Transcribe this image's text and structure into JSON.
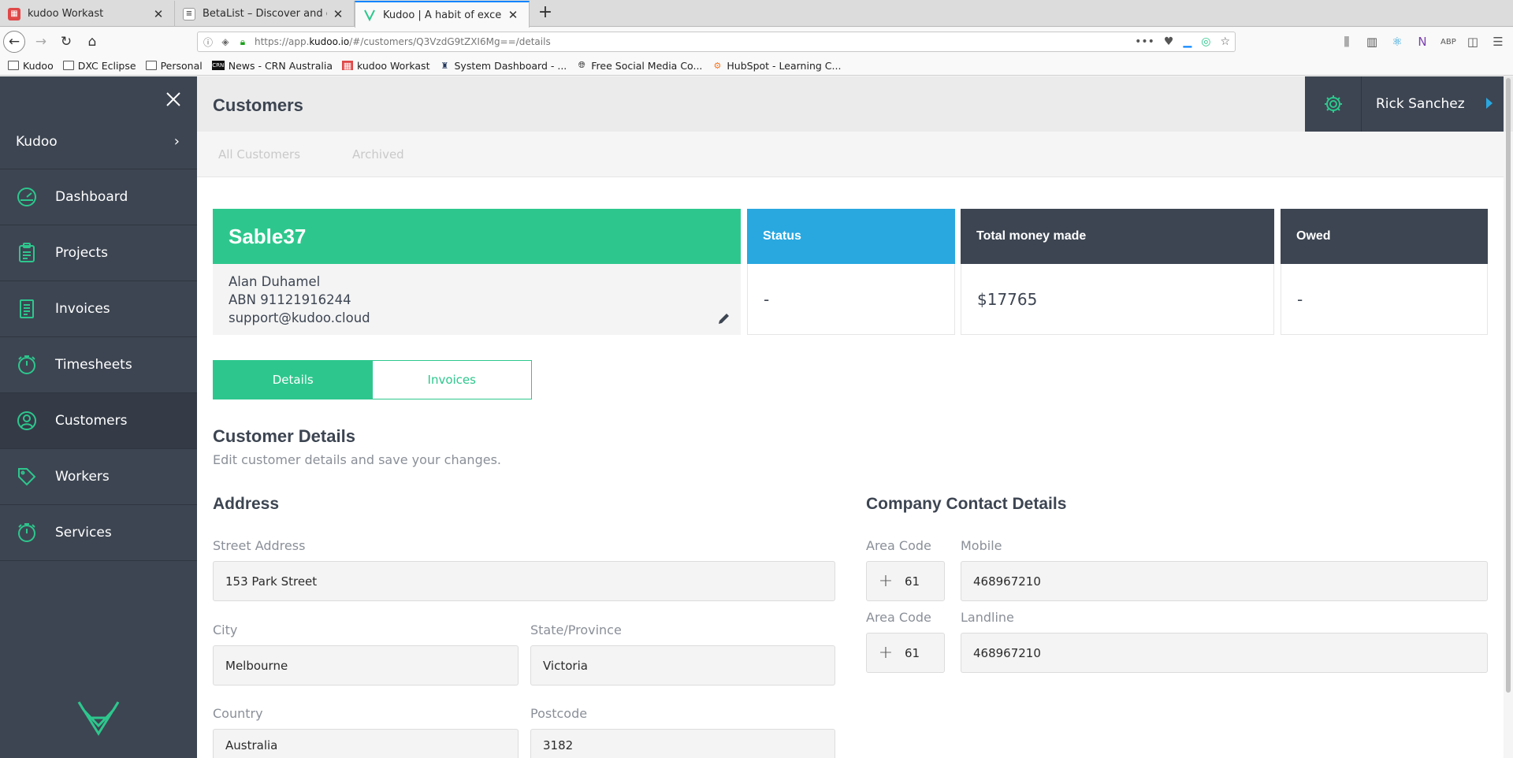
{
  "browser": {
    "tabs": [
      {
        "title": "kudoo Workast",
        "favicon_color": "#e04848"
      },
      {
        "title": "BetaList – Discover and get early",
        "favicon_color": "#9a9a9a"
      },
      {
        "title": "Kudoo | A habit of excellence",
        "favicon_color": "#2dc78d"
      }
    ],
    "url_prefix": "https://app.",
    "url_domain": "kudoo.io",
    "url_path": "/#/customers/Q3VzdG9tZXI6Mg==/details",
    "bookmarks": [
      {
        "label": "Kudoo",
        "icon": "folder-icon"
      },
      {
        "label": "DXC Eclipse",
        "icon": "folder-icon"
      },
      {
        "label": "Personal",
        "icon": "folder-icon"
      },
      {
        "label": "News - CRN Australia",
        "icon": "crn-icon"
      },
      {
        "label": "kudoo Workast",
        "icon": "workast-icon"
      },
      {
        "label": "System Dashboard - ...",
        "icon": "jira-icon"
      },
      {
        "label": "Free Social Media Co...",
        "icon": "globe-icon"
      },
      {
        "label": "HubSpot - Learning C...",
        "icon": "hubspot-icon"
      }
    ]
  },
  "sidebar": {
    "org": "Kudoo",
    "items": [
      {
        "label": "Dashboard",
        "icon": "dashboard-icon"
      },
      {
        "label": "Projects",
        "icon": "clipboard-icon"
      },
      {
        "label": "Invoices",
        "icon": "invoice-icon"
      },
      {
        "label": "Timesheets",
        "icon": "stopwatch-icon"
      },
      {
        "label": "Customers",
        "icon": "user-icon"
      },
      {
        "label": "Workers",
        "icon": "tag-icon"
      },
      {
        "label": "Services",
        "icon": "stopwatch-icon"
      }
    ],
    "active": "Customers"
  },
  "header": {
    "title": "Customers",
    "user": "Rick Sanchez"
  },
  "subtabs": [
    "All Customers",
    "Archived"
  ],
  "customer": {
    "name": "Sable37",
    "contact": "Alan Duhamel",
    "abn": "ABN 91121916244",
    "email": "support@kudoo.cloud"
  },
  "stats": {
    "status_label": "Status",
    "status_value": "-",
    "money_label": "Total money made",
    "money_value": "$17765",
    "owed_label": "Owed",
    "owed_value": "-"
  },
  "toggle": {
    "details": "Details",
    "invoices": "Invoices"
  },
  "details": {
    "title": "Customer Details",
    "subtitle": "Edit customer details and save your changes.",
    "address_title": "Address",
    "street_label": "Street Address",
    "street_value": "153 Park Street",
    "city_label": "City",
    "city_value": "Melbourne",
    "state_label": "State/Province",
    "state_value": "Victoria",
    "country_label": "Country",
    "country_value": "Australia",
    "postcode_label": "Postcode",
    "postcode_value": "3182",
    "contact_title": "Company Contact Details",
    "area_label": "Area Code",
    "mobile_label": "Mobile",
    "mobile_area": "61",
    "mobile_value": "468967210",
    "landline_label": "Landline",
    "landline_area": "61",
    "landline_value": "468967210"
  },
  "colors": {
    "accent_green": "#2dc78d",
    "accent_blue": "#29a8e0",
    "sidebar_dark": "#3d4552"
  }
}
